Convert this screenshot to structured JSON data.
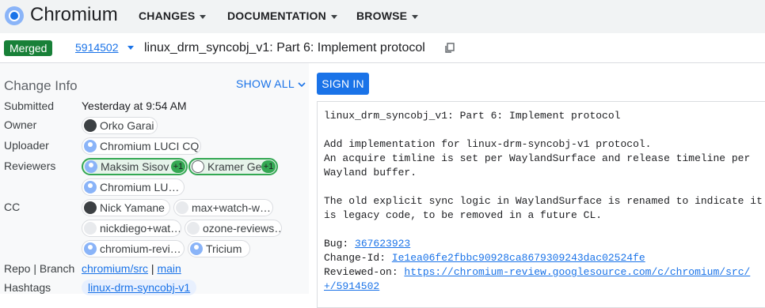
{
  "header": {
    "app_title": "Chromium",
    "logo_icon": "chromium-logo-icon",
    "nav": [
      "CHANGES",
      "DOCUMENTATION",
      "BROWSE"
    ]
  },
  "change": {
    "status": "Merged",
    "number": "5914502",
    "title": "linux_drm_syncobj_v1: Part 6: Implement protocol"
  },
  "change_info": {
    "section_title": "Change Info",
    "show_all": "SHOW ALL",
    "submitted_label": "Submitted",
    "submitted_value": "Yesterday at 9:54 AM",
    "owner_label": "Owner",
    "owner": "Orko Garai",
    "uploader_label": "Uploader",
    "uploader": "Chromium LUCI CQ",
    "reviewers_label": "Reviewers",
    "reviewers": [
      {
        "name": "Maksim Sisov",
        "vote": "+1"
      },
      {
        "name": "Kramer Ge",
        "vote": "+1"
      },
      {
        "name": "Chromium LU…"
      }
    ],
    "cc_label": "CC",
    "cc": [
      "Nick Yamane",
      "max+watch-w…",
      "nickdiego+wat…",
      "ozone-reviews…",
      "chromium-revi…",
      "Tricium"
    ],
    "repo_branch_label": "Repo | Branch",
    "repo": "chromium/src",
    "branch_sep": " | ",
    "branch": "main",
    "hashtags_label": "Hashtags",
    "hashtag": "linux-drm-syncobj-v1"
  },
  "actions": {
    "sign_in": "SIGN IN"
  },
  "commit_message": {
    "subject": "linux_drm_syncobj_v1: Part 6: Implement protocol",
    "body1_line1": "Add implementation for linux-drm-syncobj-v1 protocol.",
    "body1_line2": "An acquire timline is set per WaylandSurface and release timeline per",
    "body1_line3": "Wayland buffer.",
    "body2_line1": "The old explicit sync logic in WaylandSurface is renamed to indicate it",
    "body2_line2": "is legacy code, to be removed in a future CL.",
    "bug_label": "Bug: ",
    "bug": "367623923",
    "change_id_label": "Change-Id: ",
    "change_id": "Ie1ea06fe2fbbc90928ca8679309243dac02524fe",
    "reviewed_on_label": "Reviewed-on: ",
    "reviewed_on_1": "https://chromium-review.googlesource.com/c/chromium/src/",
    "reviewed_on_2": "+/5914502"
  },
  "colors": {
    "accent": "#1a73e8",
    "merged": "#188038",
    "vote": "#34a853"
  }
}
